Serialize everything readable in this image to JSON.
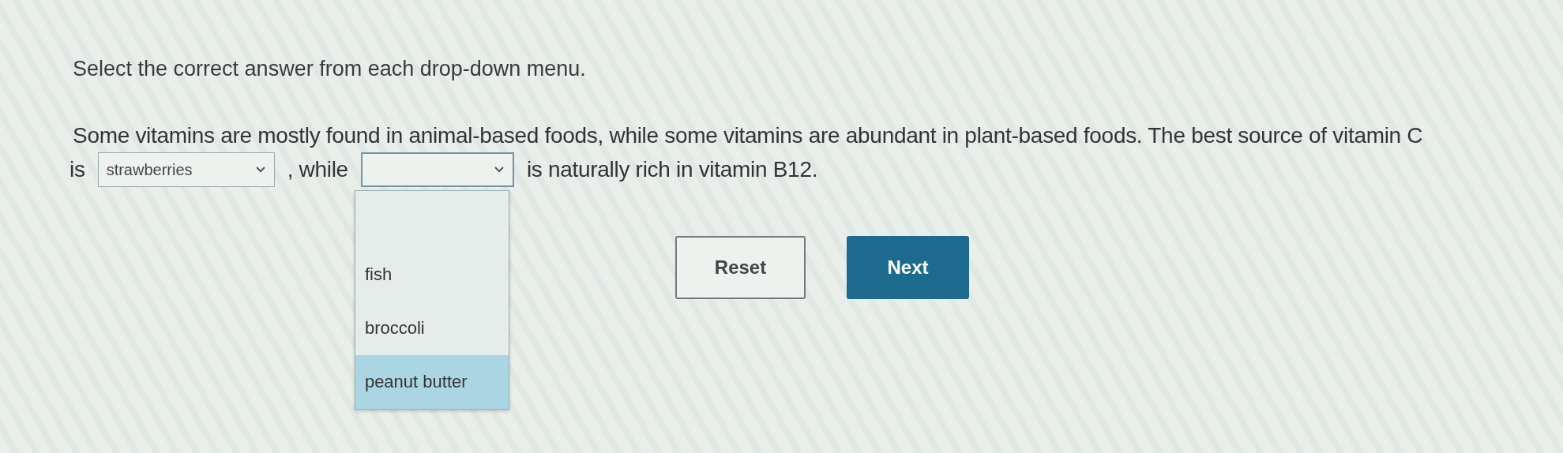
{
  "instruction": "Select the correct answer from each drop-down menu.",
  "lines": [
    [
      {
        "kind": "text",
        "text": "Some vitamins are mostly found in animal-based foods, while some vitamins are abundant in plant-based foods. The best source of vitamin C"
      }
    ],
    [
      {
        "kind": "text",
        "text": "is"
      },
      {
        "kind": "dropdown",
        "value": "strawberries",
        "expanded": false
      },
      {
        "kind": "text",
        "text": ", while"
      },
      {
        "kind": "dropdown",
        "expanded": true,
        "options": [
          {
            "label": "fish",
            "highlighted": false
          },
          {
            "label": "broccoli",
            "highlighted": false
          },
          {
            "label": "peanut butter",
            "highlighted": true
          }
        ]
      },
      {
        "kind": "text",
        "text": "is naturally rich in vitamin B12."
      }
    ]
  ],
  "buttons": [
    {
      "kind": "secondary",
      "label": "Reset"
    },
    {
      "kind": "primary",
      "label": "Next"
    }
  ]
}
